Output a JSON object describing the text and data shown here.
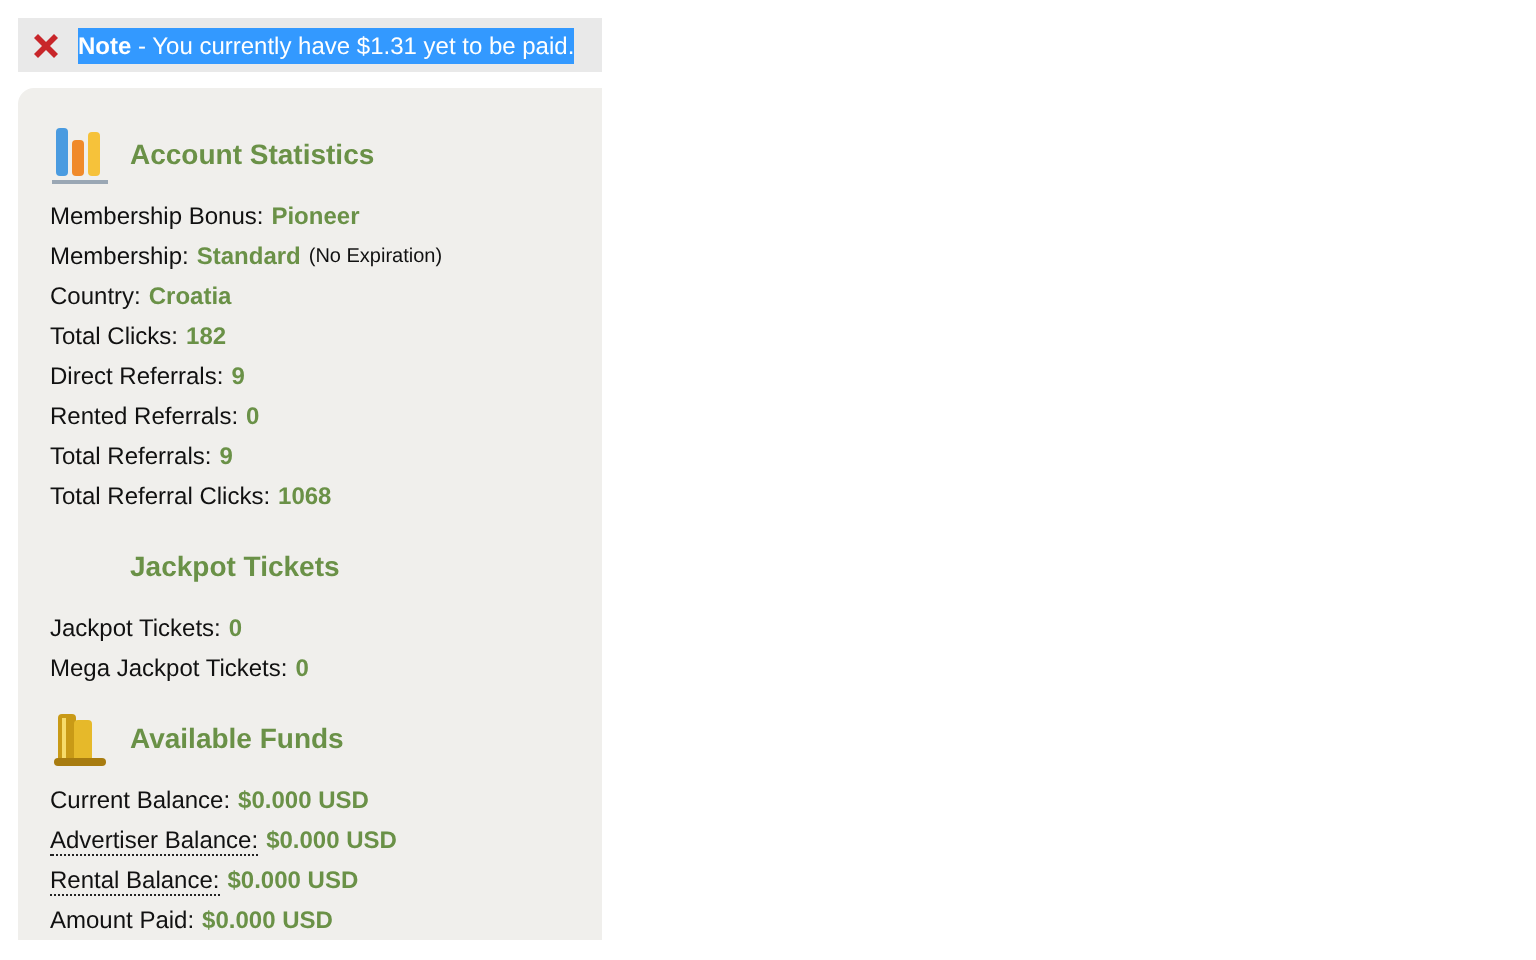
{
  "note": {
    "label": "Note",
    "text": " - You currently have $1.31 yet to be paid.",
    "selected": true
  },
  "sections": [
    {
      "title": "Account Statistics",
      "kind": "chart",
      "rows": [
        {
          "label": "Membership Bonus:",
          "value": "Pioneer"
        },
        {
          "label": "Membership:",
          "value": "Standard",
          "extra": "(No Expiration)"
        },
        {
          "label": "Country:",
          "value": "Croatia"
        },
        {
          "label": "Total Clicks:",
          "value": "182"
        },
        {
          "label": "Direct Referrals:",
          "value": "9"
        },
        {
          "label": "Rented Referrals:",
          "value": "0"
        },
        {
          "label": "Total Referrals:",
          "value": "9"
        },
        {
          "label": "Total Referral Clicks:",
          "value": "1068"
        }
      ]
    },
    {
      "title": "Jackpot Tickets",
      "kind": "plain",
      "rows": [
        {
          "label": "Jackpot Tickets:",
          "value": "0"
        },
        {
          "label": "Mega Jackpot Tickets:",
          "value": "0"
        }
      ]
    },
    {
      "title": "Available Funds",
      "kind": "funds",
      "rows": [
        {
          "label": "Current Balance:",
          "value": "$0.000 USD",
          "dotted": false
        },
        {
          "label": "Advertiser Balance:",
          "value": "$0.000 USD",
          "dotted": true
        },
        {
          "label": "Rental Balance:",
          "value": "$0.000 USD",
          "dotted": true
        },
        {
          "label": "Amount Paid:",
          "value": "$0.000 USD",
          "dotted": false
        }
      ]
    }
  ]
}
